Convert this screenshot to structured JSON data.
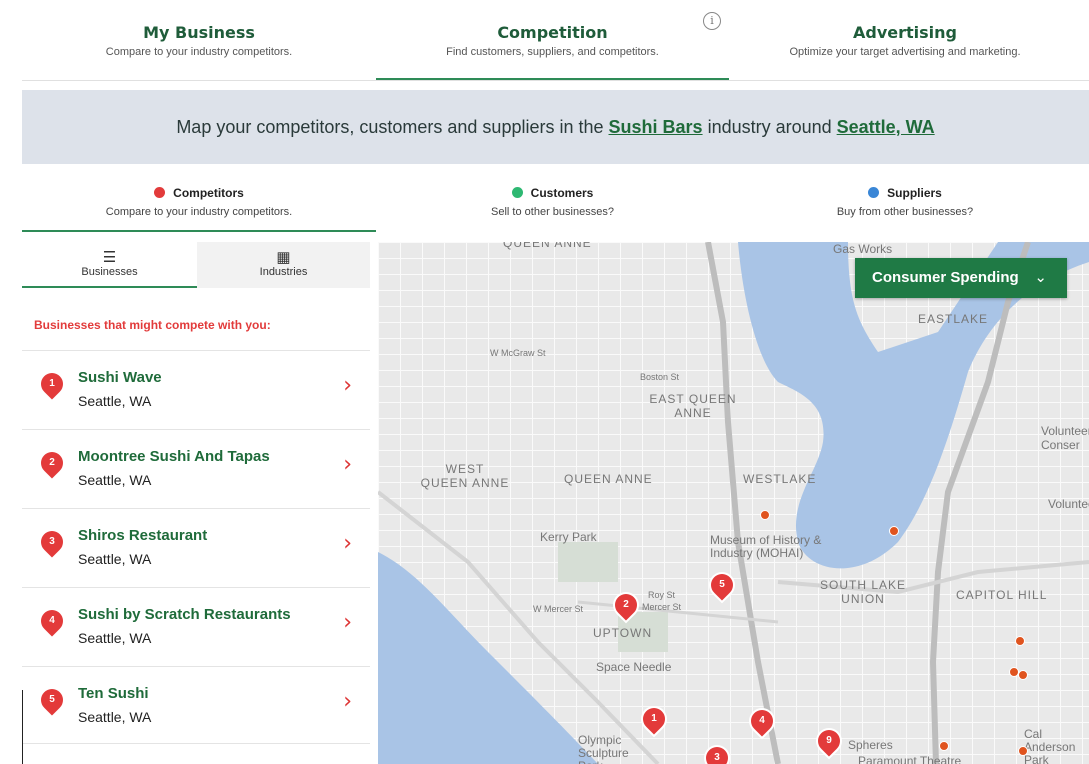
{
  "top_tabs": [
    {
      "title": "My Business",
      "subtitle": "Compare to your industry competitors."
    },
    {
      "title": "Competition",
      "subtitle": "Find customers, suppliers, and competitors."
    },
    {
      "title": "Advertising",
      "subtitle": "Optimize your target advertising and marketing."
    }
  ],
  "info_icon": "i",
  "banner": {
    "prefix": "Map your competitors, customers and suppliers in the ",
    "industry": "Sushi Bars",
    "middle": " industry around ",
    "location": "Seattle, WA"
  },
  "categories": [
    {
      "title": "Competitors",
      "subtitle": "Compare to your industry competitors.",
      "color": "#e23b3b"
    },
    {
      "title": "Customers",
      "subtitle": "Sell to other businesses?",
      "color": "#2eb872"
    },
    {
      "title": "Suppliers",
      "subtitle": "Buy from other businesses?",
      "color": "#3a86d6"
    }
  ],
  "sub_tabs": [
    {
      "label": "Businesses",
      "icon": "list-icon"
    },
    {
      "label": "Industries",
      "icon": "building-icon"
    }
  ],
  "list_heading": "Businesses that might compete with you:",
  "businesses": [
    {
      "num": "1",
      "name": "Sushi Wave",
      "location": "Seattle, WA"
    },
    {
      "num": "2",
      "name": "Moontree Sushi And Tapas",
      "location": "Seattle, WA"
    },
    {
      "num": "3",
      "name": "Shiros Restaurant",
      "location": "Seattle, WA"
    },
    {
      "num": "4",
      "name": "Sushi by Scratch Restaurants",
      "location": "Seattle, WA"
    },
    {
      "num": "5",
      "name": "Ten Sushi",
      "location": "Seattle, WA"
    }
  ],
  "map": {
    "spending_label": "Consumer Spending",
    "labels": {
      "east_queen_anne": "EAST QUEEN ANNE",
      "west_queen_anne": "WEST QUEEN ANNE",
      "queen_anne": "QUEEN ANNE",
      "queen_anne_top": "QUEEN ANNE",
      "westlake": "WESTLAKE",
      "eastlake": "EASTLAKE",
      "uptown": "UPTOWN",
      "south_lake_union": "SOUTH LAKE UNION",
      "capitol_hill": "CAPITOL HILL",
      "gas_works": "Gas Works",
      "kerry_park": "Kerry Park",
      "museum": "Museum of History & Industry (MOHAI)",
      "space_needle": "Space Needle",
      "olympic": "Olympic Sculpture Park",
      "spheres": "Spheres",
      "paramount": "Paramount Theatre",
      "cal_anderson": "Cal Anderson Park",
      "volunteer": "Volunteer",
      "volunteer2": "Volunteer Conser",
      "boston_st": "Boston St",
      "mcgraw": "W McGraw St",
      "roy_st": "Roy St",
      "mercer": "Mercer St",
      "w_mercer": "W Mercer St"
    },
    "pins": [
      "5",
      "2",
      "1",
      "4",
      "9",
      "3"
    ]
  }
}
